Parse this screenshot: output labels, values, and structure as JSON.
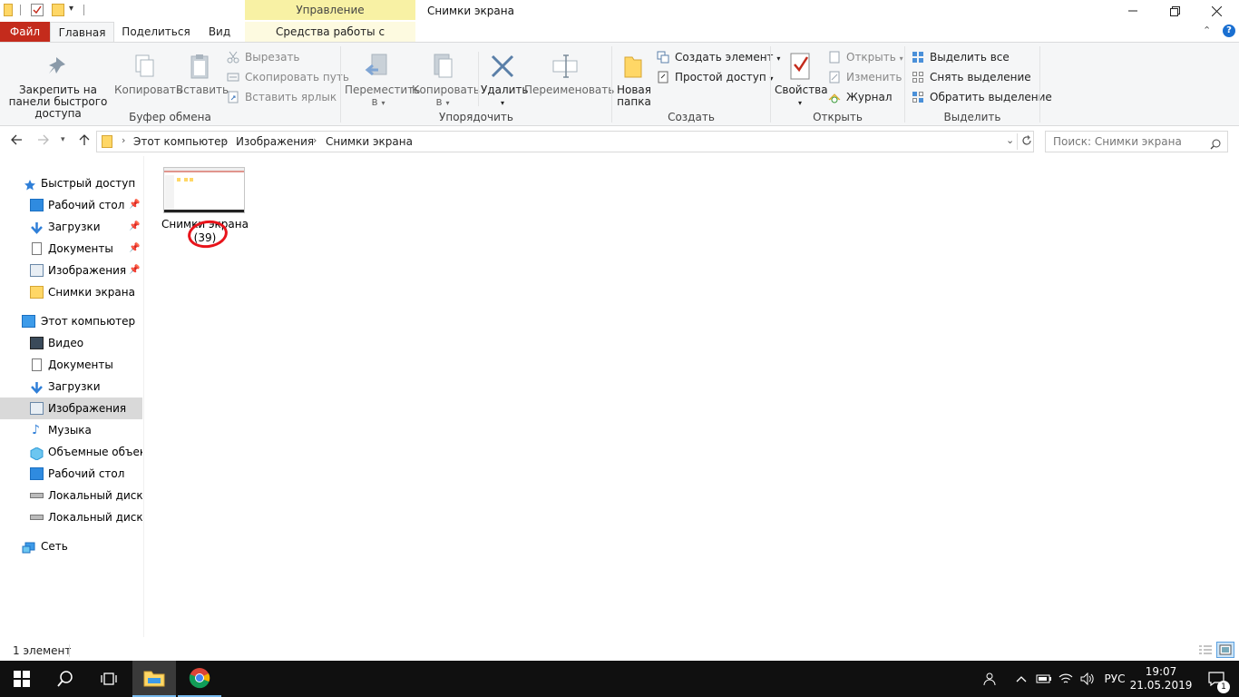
{
  "window": {
    "title": "Снимки экрана",
    "contextual_group": "Управление",
    "contextual_tab": "Средства работы с рисунками"
  },
  "tabs": {
    "file": "Файл",
    "home": "Главная",
    "share": "Поделиться",
    "view": "Вид"
  },
  "ribbon": {
    "clipboard": {
      "label": "Буфер обмена",
      "pin": "Закрепить на панели быстрого доступа",
      "copy": "Копировать",
      "paste": "Вставить",
      "cut": "Вырезать",
      "copy_path": "Скопировать путь",
      "paste_shortcut": "Вставить ярлык"
    },
    "organize": {
      "label": "Упорядочить",
      "move": "Переместить в",
      "copy_to": "Копировать в",
      "delete": "Удалить",
      "rename": "Переименовать"
    },
    "create": {
      "label": "Создать",
      "new_folder": "Новая папка",
      "new_item": "Создать элемент",
      "easy_access": "Простой доступ"
    },
    "open": {
      "label": "Открыть",
      "properties": "Свойства",
      "open": "Открыть",
      "edit": "Изменить",
      "history": "Журнал"
    },
    "select": {
      "label": "Выделить",
      "select_all": "Выделить все",
      "select_none": "Снять выделение",
      "invert": "Обратить выделение"
    }
  },
  "address": {
    "crumbs": [
      "Этот компьютер",
      "Изображения",
      "Снимки экрана"
    ],
    "search_placeholder": "Поиск: Снимки экрана"
  },
  "sidebar": {
    "quick_access": "Быстрый доступ",
    "quick_items": [
      "Рабочий стол",
      "Загрузки",
      "Документы",
      "Изображения",
      "Снимки экрана"
    ],
    "this_pc": "Этот компьютер",
    "pc_items": [
      "Видео",
      "Документы",
      "Загрузки",
      "Изображения",
      "Музыка",
      "Объемные объекты",
      "Рабочий стол",
      "Локальный диск (C:)",
      "Локальный диск (D:)"
    ],
    "network": "Сеть"
  },
  "content": {
    "item_name": "Снимки экрана",
    "item_suffix": "(39)"
  },
  "status": {
    "count": "1 элемент"
  },
  "taskbar": {
    "lang": "РУС",
    "time": "19:07",
    "date": "21.05.2019",
    "notifications": "1"
  },
  "colors": {
    "file_tab": "#c42b1c",
    "contextual": "#f8f1a4",
    "selection": "#d9d9d9",
    "folder": "#ffd766",
    "taskbar": "#101010",
    "annotation": "#e8141b"
  }
}
